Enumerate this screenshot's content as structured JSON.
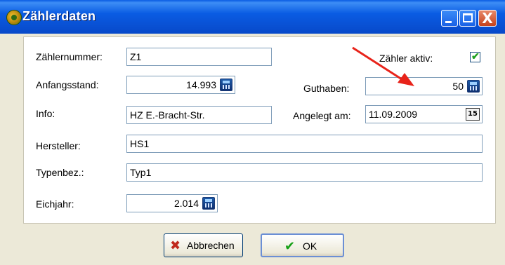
{
  "window": {
    "title": "Zählerdaten",
    "controls": {
      "minimize": "_",
      "maximize": "□",
      "close": "X"
    }
  },
  "form": {
    "zaehlernummer": {
      "label": "Zählernummer:",
      "value": "Z1"
    },
    "zaehler_aktiv": {
      "label": "Zähler aktiv:",
      "checked": true,
      "mark": "✔"
    },
    "anfangsstand": {
      "label": "Anfangsstand:",
      "value": "14.993",
      "icon": "calculator-icon"
    },
    "guthaben": {
      "label": "Guthaben:",
      "value": "50",
      "icon": "calculator-icon"
    },
    "info": {
      "label": "Info:",
      "value": "HZ E.-Bracht-Str."
    },
    "angelegt_am": {
      "label": "Angelegt am:",
      "value": "11.09.2009",
      "icon_text": "15"
    },
    "hersteller": {
      "label": "Hersteller:",
      "value": "HS1"
    },
    "typenbez": {
      "label": "Typenbez.:",
      "value": "Typ1"
    },
    "eichjahr": {
      "label": "Eichjahr:",
      "value": "2.014",
      "icon": "calculator-icon"
    }
  },
  "buttons": {
    "cancel": {
      "label": "Abbrechen",
      "icon": "✖"
    },
    "ok": {
      "label": "OK",
      "icon": "✔"
    }
  },
  "annotation": {
    "arrow_color": "#e8231a"
  }
}
